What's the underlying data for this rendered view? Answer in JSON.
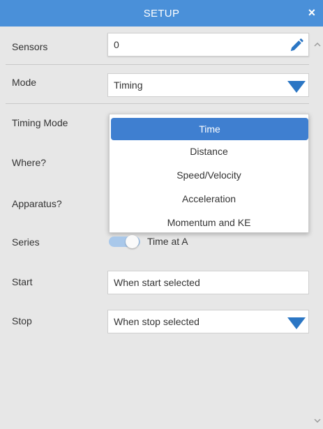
{
  "header": {
    "title": "SETUP",
    "close_label": "×"
  },
  "rows": {
    "sensors": {
      "label": "Sensors",
      "value": "0"
    },
    "mode": {
      "label": "Mode",
      "value": "Timing"
    },
    "timing_mode": {
      "label": "Timing Mode"
    },
    "where": {
      "label": "Where?"
    },
    "apparatus": {
      "label": "Apparatus?"
    },
    "series": {
      "label": "Series",
      "toggle_label": "Time at A"
    },
    "start": {
      "label": "Start",
      "value": "When start selected"
    },
    "stop": {
      "label": "Stop",
      "value": "When stop selected"
    }
  },
  "timing_mode_dropdown": {
    "selected": "Time",
    "options": [
      "Time",
      "Distance",
      "Speed/Velocity",
      "Acceleration",
      "Momentum and KE"
    ]
  },
  "colors": {
    "header_bg": "#4a90d9",
    "accent": "#2b76c4",
    "selected_item": "#3f7fd0",
    "panel_bg": "#e7e7e7"
  },
  "icons": [
    "close-icon",
    "pencil-icon",
    "dropdown-triangle-icon",
    "scroll-up-icon",
    "scroll-down-icon"
  ]
}
